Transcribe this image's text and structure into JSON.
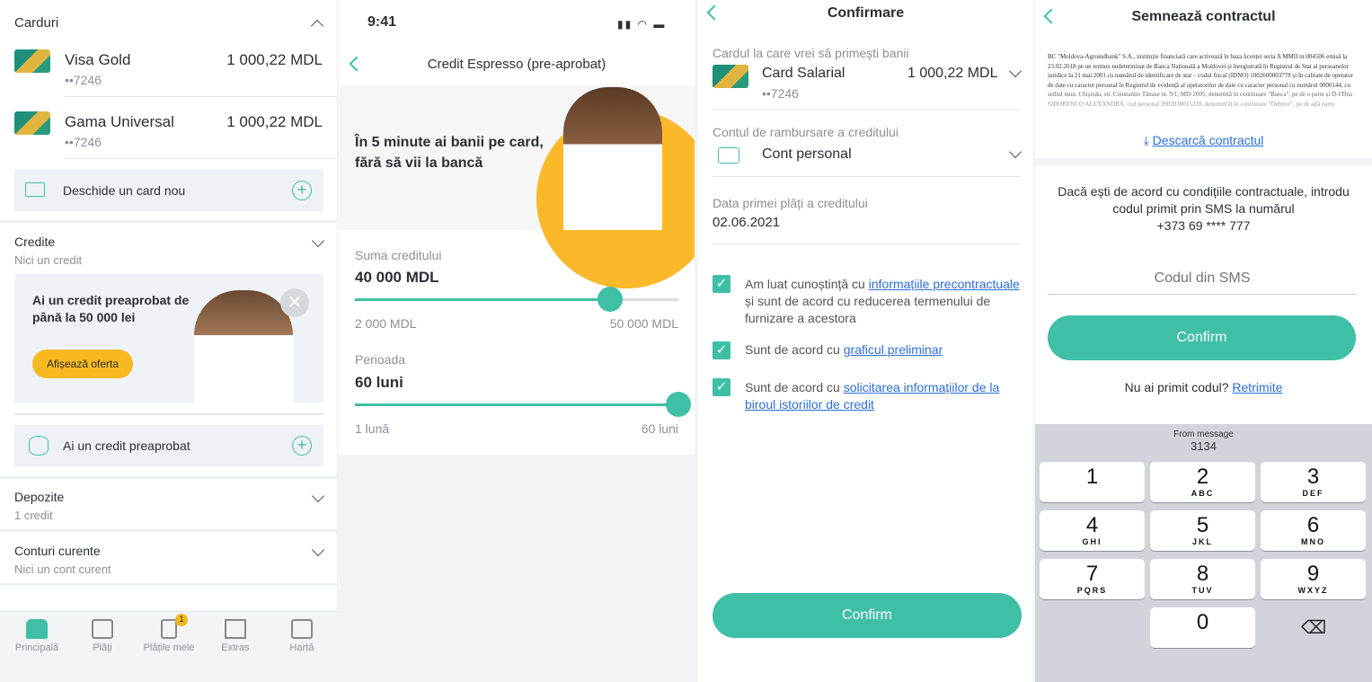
{
  "panel1": {
    "cards_title": "Carduri",
    "cards": [
      {
        "name": "Visa Gold",
        "number": "••7246",
        "balance": "1 000,22 MDL"
      },
      {
        "name": "Gama Universal",
        "number": "••7246",
        "balance": "1 000,22 MDL"
      }
    ],
    "open_card": "Deschide  un card nou",
    "credits_title": "Credite",
    "credits_sub": "Nici un credit",
    "promo_text": "Ai un credit preaprobat de până la 50 000 lei",
    "promo_button": "Afișează oferta",
    "preapproved": "Ai un credit preaprobat",
    "deposits_title": "Depozite",
    "deposits_sub": "1 credit",
    "accounts_title": "Conturi curente",
    "accounts_sub": "Nici un cont curent",
    "nav": [
      {
        "label": "Principală",
        "icon": "home-icon"
      },
      {
        "label": "Plăți",
        "icon": "transfer-icon"
      },
      {
        "label": "Plățile mele",
        "icon": "document-icon",
        "badge": "1"
      },
      {
        "label": "Extras",
        "icon": "bar-chart-icon"
      },
      {
        "label": "Hartă",
        "icon": "map-icon"
      }
    ]
  },
  "panel2": {
    "time": "9:41",
    "title": "Credit Espresso (pre-aprobat)",
    "hero": "În 5 minute ai banii pe card, fără să vii la bancă",
    "amount_label": "Suma creditului",
    "amount_value": "40 000 MDL",
    "amount_min": "2 000 MDL",
    "amount_max": "50 000 MDL",
    "amount_fraction": 0.79,
    "period_label": "Perioada",
    "period_value": "60 luni",
    "period_min": "1 lună",
    "period_max": "60 luni",
    "period_fraction": 1.0
  },
  "panel3": {
    "title": "Confirmare",
    "card_label": "Cardul la care vrei să primești banii",
    "card_name": "Card Salarial",
    "card_number": "••7246",
    "card_balance": "1 000,22 MDL",
    "repay_label": "Contul de rambursare a creditului",
    "repay_value": "Cont personal",
    "date_label": "Data primei plăți a creditului",
    "date_value": "02.06.2021",
    "check1_a": "Am luat cunoștință cu ",
    "check1_link": "informațiile precontractuale",
    "check1_b": " și sunt de acord cu reducerea termenului de furnizare a acestora",
    "check2_a": "Sunt de acord cu ",
    "check2_link": "graficul preliminar",
    "check3_a": "Sunt de acord cu ",
    "check3_link": "solicitarea informațiilor de la biroul istoriilor de credit",
    "confirm": "Confirm"
  },
  "panel4": {
    "title": "Semnează contractul",
    "contract_text": "BC \"Moldova-Agroindbank\" S.A., instituție financiară care activează în baza licenței seria A MMII nr.004506 emisă la 23.02.2018 pe un termen nedeterminat de Banca Națională a Moldovei și înregistrată în Registrul de Stat al persoanelor juridice la 21 mai 2001 cu numărul de identificare de stat – codul fiscal (IDNO) 1002600003778 și în calitate de operator de date cu caracter personal în Registrul de evidență al operatorilor de date cu caracter personal cu numărul 0000144, cu sediul mun. Chișinău, str. Constantin Tănase nr. 9/1, MD-2005, denumită în continuare \"Banca\", pe de o parte și D-l/Dna SIDORENCO ALEXANDRA, cod personal 2002030015220, denumit(ă) în continuare \"Debitor\", pe de altă parte.",
    "download": "Descarcă contractul",
    "info": "Dacă ești de acord cu condițiile contractuale, introdu codul primit prin SMS la numărul",
    "phone": "+373 69 **** 777",
    "sms_placeholder": "Codul din SMS",
    "confirm": "Confirm",
    "resend_q": "Nu ai primit codul? ",
    "resend": "Retrimite",
    "suggest_label": "From message",
    "suggest_code": "3134",
    "keys": [
      {
        "n": "1",
        "l": ""
      },
      {
        "n": "2",
        "l": "ABC"
      },
      {
        "n": "3",
        "l": "DEF"
      },
      {
        "n": "4",
        "l": "GHI"
      },
      {
        "n": "5",
        "l": "JKL"
      },
      {
        "n": "6",
        "l": "MNO"
      },
      {
        "n": "7",
        "l": "PQRS"
      },
      {
        "n": "8",
        "l": "TUV"
      },
      {
        "n": "9",
        "l": "WXYZ"
      },
      {
        "n": "0",
        "l": ""
      }
    ]
  },
  "colors": {
    "accent": "#3fbfa6",
    "promo_button": "#f8b820",
    "link": "#2b6ed9"
  }
}
